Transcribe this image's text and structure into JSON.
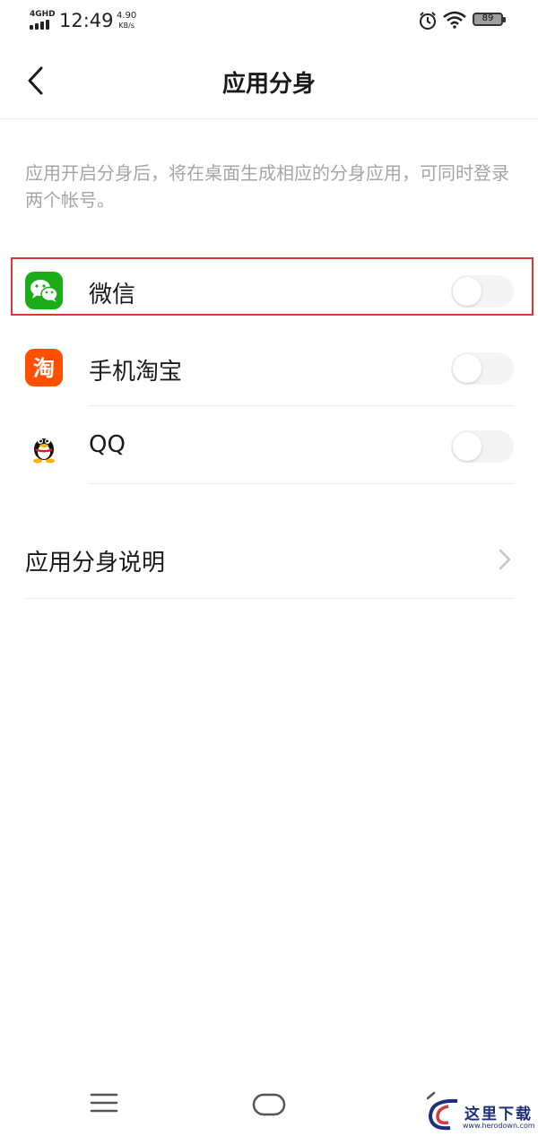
{
  "status_bar": {
    "network": "4GHD",
    "time": "12:49",
    "speed_value": "4.90",
    "speed_unit": "KB/s",
    "battery": "89",
    "icons": [
      "signal-icon",
      "alarm-icon",
      "wifi-icon",
      "battery-icon"
    ]
  },
  "header": {
    "title": "应用分身",
    "back_icon": "back-arrow-icon"
  },
  "description": "应用开启分身后，将在桌面生成相应的分身应用，可同时登录两个帐号。",
  "apps": [
    {
      "name": "微信",
      "icon": "wechat-icon",
      "enabled": false,
      "highlighted": true
    },
    {
      "name": "手机淘宝",
      "icon": "taobao-icon",
      "enabled": false
    },
    {
      "name": "QQ",
      "icon": "qq-icon",
      "enabled": false
    }
  ],
  "explanation": {
    "label": "应用分身说明",
    "icon": "chevron-right-icon"
  },
  "nav_bar": {
    "icons": [
      "menu-icon",
      "home-icon",
      "back-icon"
    ]
  },
  "watermark": {
    "text": "这里下载",
    "url": "www.herodown.com"
  },
  "colors": {
    "highlight": "#d9383a",
    "wechat": "#1aad19",
    "taobao": "#ff5000",
    "description": "#a5a5a5"
  }
}
